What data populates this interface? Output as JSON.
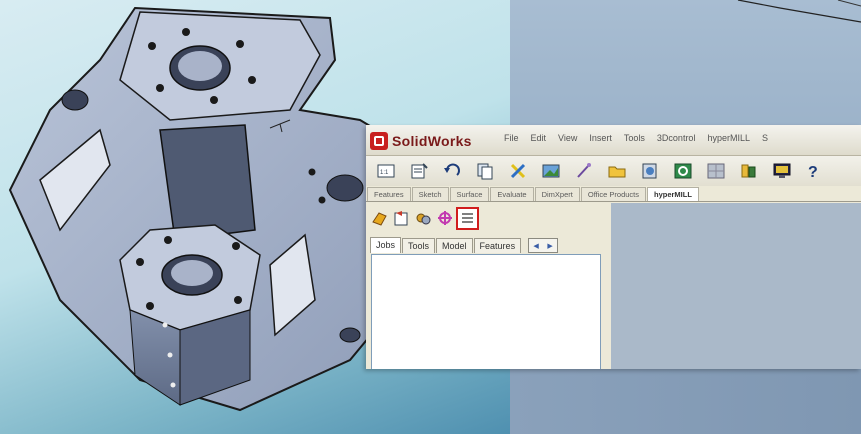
{
  "app": {
    "logo_text": "SolidWorks"
  },
  "menu": [
    "File",
    "Edit",
    "View",
    "Insert",
    "Tools",
    "3Dcontrol",
    "hyperMILL",
    "S"
  ],
  "toolbar": {
    "buttons": [
      "new-icon",
      "options-icon",
      "undo-icon",
      "copy-icon",
      "delete-icon",
      "image-icon",
      "sketch-icon",
      "folder-icon",
      "tool-db-icon",
      "refresh-icon",
      "grid-icon",
      "database-icon",
      "monitor-icon",
      "help-icon"
    ]
  },
  "command_tabs": [
    "Features",
    "Sketch",
    "Surface",
    "Evaluate",
    "DimXpert",
    "Office Products",
    "hyperMILL"
  ],
  "active_command_tab": "hyperMILL",
  "panel": {
    "icons": [
      "feature-tree-icon",
      "property-icon",
      "config-icon",
      "dimxpert-icon",
      "hypermill-browser-icon"
    ],
    "highlighted_icon": "hypermill-browser-icon",
    "tabs": [
      "Jobs",
      "Tools",
      "Model",
      "Features"
    ],
    "active_tab": "Jobs"
  },
  "colors": {
    "highlight": "#d11d1d",
    "sw_red": "#c8201f"
  }
}
